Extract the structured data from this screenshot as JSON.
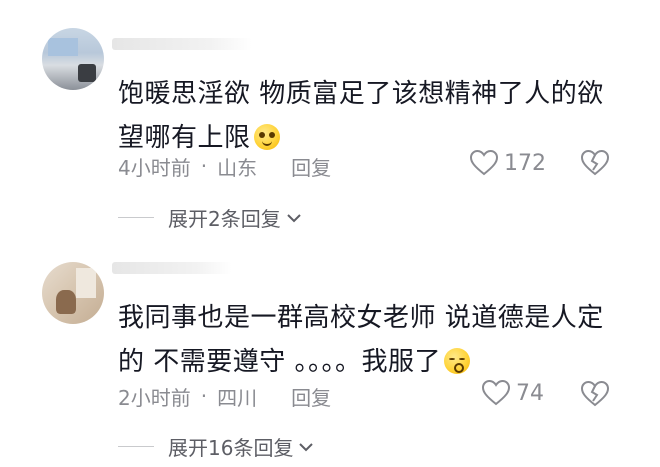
{
  "comments": [
    {
      "text": "饱暖思淫欲 物质富足了该想精神了人的欲望哪有上限",
      "emoji": "smiling-face-emoji",
      "time": "4小时前",
      "location": "山东",
      "reply_label": "回复",
      "likes": "172",
      "expand_label": "展开2条回复"
    },
    {
      "text": "我同事也是一群高校女老师 说道德是人定的 不需要遵守 。。。。我服了",
      "emoji": "kissing-blush-emoji",
      "time": "2小时前",
      "location": "四川",
      "reply_label": "回复",
      "likes": "74",
      "expand_label": "展开16条回复"
    }
  ],
  "separator": "·",
  "colors": {
    "text": "#161823",
    "meta": "#8a8b91",
    "expand": "#5d5e65"
  }
}
